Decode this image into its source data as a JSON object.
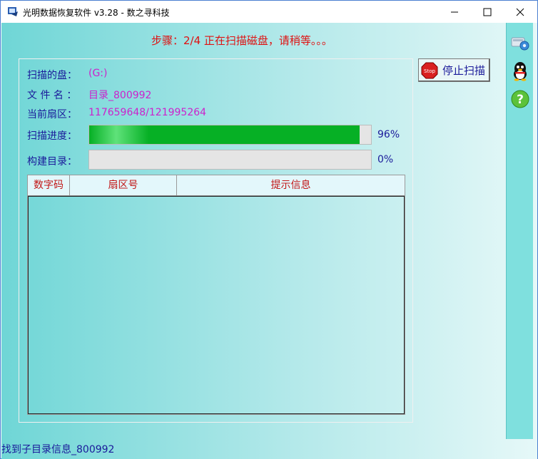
{
  "window": {
    "title": "光明数据恢复软件 v3.28 - 数之寻科技"
  },
  "step": {
    "text": "步骤：2/4 正在扫描磁盘，请稍等。。。"
  },
  "info": {
    "disk_label": "扫描的盘：",
    "disk_value": "(G:)",
    "file_label": "文 件 名 ：",
    "file_value": "目录_800992",
    "sector_label": "当前扇区：",
    "sector_value": "117659648/121995264"
  },
  "progress": {
    "scan_label": "扫描进度：",
    "scan_percent": "96%",
    "scan_fraction": 0.96,
    "build_label": "构建目录：",
    "build_percent": "0%",
    "build_fraction": 0.0
  },
  "list": {
    "columns": [
      "数字码",
      "扇区号",
      "提示信息"
    ],
    "rows": []
  },
  "toolbar": {
    "stop_label": "停止扫描",
    "stop_icon_text": "Stop"
  },
  "sidebar": {
    "icons": [
      "settings-icon",
      "qq-icon",
      "help-icon"
    ]
  },
  "status": {
    "text": "找到子目录信息_800992"
  },
  "colors": {
    "progress_fill": "#06b025",
    "label_text": "#1a1a9a",
    "value_text": "#cc22cc",
    "step_text": "#e01010",
    "header_text": "#c21818"
  }
}
